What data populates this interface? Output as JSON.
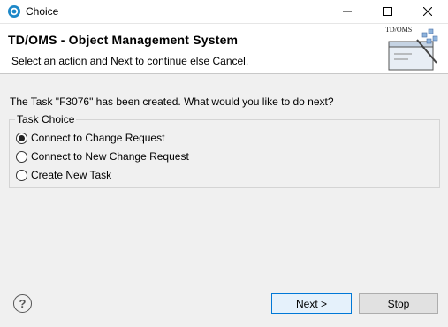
{
  "window": {
    "title": "Choice"
  },
  "header": {
    "title": "TD/OMS - Object Management System",
    "description": "Select an action and Next to continue else Cancel.",
    "banner_text": "TD/OMS"
  },
  "message": "The Task \"F3076\" has been created. What would you like to do next?",
  "task_choice": {
    "label": "Task Choice",
    "options": [
      {
        "label": "Connect to Change Request",
        "selected": true
      },
      {
        "label": "Connect to New Change Request",
        "selected": false
      },
      {
        "label": "Create New Task",
        "selected": false
      }
    ]
  },
  "buttons": {
    "help": "?",
    "next": "Next >",
    "stop": "Stop"
  },
  "colors": {
    "accent": "#0078d7",
    "window_bg": "#f0f0f0",
    "header_bg": "#ffffff"
  }
}
